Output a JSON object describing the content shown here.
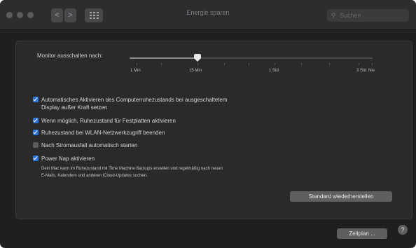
{
  "window": {
    "title": "Energie sparen"
  },
  "toolbar": {
    "back": "<",
    "forward": ">",
    "search_placeholder": "Suchen"
  },
  "slider": {
    "label": "Monitor ausschalten nach:",
    "value_label": "15 Min",
    "ticks": [
      "1 Min",
      "15 Min",
      "1 Std",
      "3 Std",
      "Nie"
    ]
  },
  "options": [
    {
      "label": "Automatisches Aktivieren des Computerruhezustands bei ausgeschaltetem",
      "label2": "Display außer Kraft setzen",
      "checked": true
    },
    {
      "label": "Wenn möglich, Ruhezustand für Festplatten aktivieren",
      "checked": true
    },
    {
      "label": "Ruhezustand bei WLAN-Netzwerkzugriff beenden",
      "checked": true
    },
    {
      "label": "Nach Stromausfall automatisch starten",
      "checked": false
    },
    {
      "label": "Power Nap aktivieren",
      "checked": true
    }
  ],
  "power_nap_description": [
    "Dein Mac kann im Ruhezustand mit Time Machine Backups erstellen und regelmäßig nach neuen",
    "E-Mails, Kalendern und anderen iCloud-Updates suchen."
  ],
  "buttons": {
    "restore_defaults": "Standard wiederherstellen",
    "schedule": "Zeitplan ...",
    "help": "?"
  }
}
